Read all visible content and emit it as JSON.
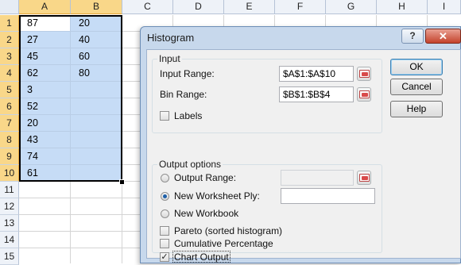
{
  "sheet": {
    "columns": [
      "A",
      "B",
      "C",
      "D",
      "E",
      "F",
      "G",
      "H",
      "I"
    ],
    "rows": [
      "1",
      "2",
      "3",
      "4",
      "5",
      "6",
      "7",
      "8",
      "9",
      "10",
      "11",
      "12",
      "13",
      "14",
      "15"
    ],
    "colA": [
      "87",
      "27",
      "45",
      "62",
      "3",
      "52",
      "20",
      "43",
      "74",
      "61"
    ],
    "colB": [
      "20",
      "40",
      "60",
      "80"
    ]
  },
  "dialog": {
    "title": "Histogram",
    "help_label": "?",
    "close_label": "✕",
    "input": {
      "group_label": "Input",
      "input_range_label": "Input Range:",
      "input_range_value": "$A$1:$A$10",
      "bin_range_label": "Bin Range:",
      "bin_range_value": "$B$1:$B$4",
      "labels_label": "Labels"
    },
    "output": {
      "group_label": "Output options",
      "output_range_label": "Output Range:",
      "output_range_value": "",
      "new_ply_label": "New Worksheet Ply:",
      "new_ply_value": "",
      "new_workbook_label": "New Workbook",
      "pareto_label": "Pareto (sorted histogram)",
      "cumulative_label": "Cumulative Percentage",
      "chart_output_label": "Chart Output",
      "chart_output_checked": "✓"
    },
    "buttons": {
      "ok": "OK",
      "cancel": "Cancel",
      "help": "Help"
    }
  }
}
